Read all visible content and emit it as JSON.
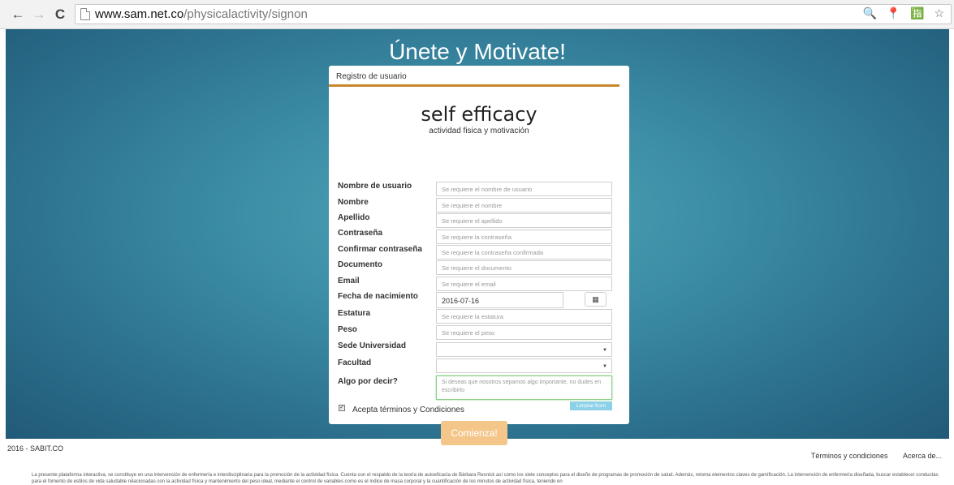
{
  "browser": {
    "back_icon": "←",
    "forward_icon": "→",
    "reload_icon": "C",
    "url_host": "www.sam.net.co",
    "url_path": "/physicalactivity/signon",
    "omnibox_icons": "🔍 📍 🈯 ☆"
  },
  "hero": {
    "title": "Únete y Motivate!"
  },
  "card": {
    "header": "Registro de usuario",
    "logo_title": "self efficacy",
    "logo_subtitle": "actividad fisica y motivación"
  },
  "form": {
    "fields": [
      {
        "label": "Nombre de usuario",
        "placeholder": "Se requiere el nombre de usuario"
      },
      {
        "label": "Nombre",
        "placeholder": "Se requiere el nombre"
      },
      {
        "label": "Apellido",
        "placeholder": "Se requiere el apellido"
      },
      {
        "label": "Contraseña",
        "placeholder": "Se requiere la contraseña"
      },
      {
        "label": "Confirmar contraseña",
        "placeholder": "Se requiere la contraseña confirmada"
      },
      {
        "label": "Documento",
        "placeholder": "Se requiere el documento"
      },
      {
        "label": "Email",
        "placeholder": "Se requiere el email"
      },
      {
        "label": "Fecha de nacimiento",
        "value": "2016-07-16",
        "icon": "calendar-icon"
      },
      {
        "label": "Estatura",
        "placeholder": "Se requiere la estatura"
      },
      {
        "label": "Peso",
        "placeholder": "Se requiere el peso"
      },
      {
        "label": "Sede Universidad",
        "value": ""
      },
      {
        "label": "Facultad",
        "value": ""
      }
    ],
    "comment_label": "Algo por decir?",
    "comment_placeholder": "Si deseas que nosotros sepamos algo importante, no dudes en escribirlo",
    "clear_button": "Limpiar from",
    "terms_label": "Acepta términos y Condiciones",
    "terms_checked": true,
    "submit_button": "Comienza!"
  },
  "footer": {
    "copyright": "2016 - SABIT.CO",
    "links": [
      "Términos y condiciones",
      "Acerca de..."
    ],
    "disclaimer": "La presente plataforma interactiva, se constituye en una intervención de enfermería e interdisciplinaria para la promoción de la actividad física. Cuenta con el respaldo de la teoría de autoeficacia de Bárbara Resnick así como los siete conceptos para el diseño de programas de promoción de salud. Además, retoma elementos claves de gamificación. La intervención de enfermería diseñada, buscar establecer conductas para el fomento de estilos de vida saludable relacionadas con la actividad física y mantenimiento del peso ideal, mediante el control de variables como es el índice de masa corporal y la cuantificación de los minutos de actividad física, teniendo en"
  },
  "colors": {
    "accent_rule": "#c8872b",
    "submit_button": "#f5c68a",
    "clear_button": "#8dd1e8",
    "hero_background": "#3a8aa3"
  }
}
